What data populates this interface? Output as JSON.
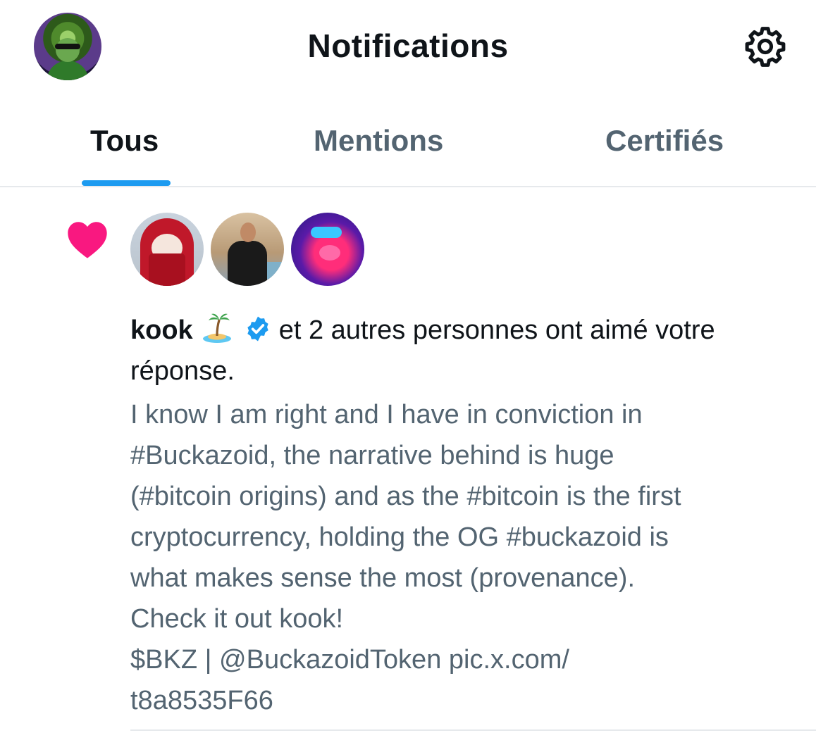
{
  "header": {
    "title": "Notifications",
    "avatar_icon": "profile-avatar",
    "settings_icon": "gear-icon"
  },
  "tabs": [
    {
      "label": "Tous",
      "active": true
    },
    {
      "label": "Mentions",
      "active": false
    },
    {
      "label": "Certifiés",
      "active": false
    }
  ],
  "colors": {
    "accent": "#1d9bf0",
    "heart": "#f91880",
    "text_primary": "#0f1419",
    "text_secondary": "#536471"
  },
  "notification": {
    "type_icon": "heart-icon",
    "likers": [
      "liker-avatar-1",
      "liker-avatar-2",
      "liker-avatar-3"
    ],
    "username": "kook",
    "username_emoji": "palm-island-emoji",
    "verified_icon": "verified-badge-icon",
    "action_text": "et 2 autres personnes ont aimé votre réponse.",
    "tweet_text": "I know I am right and I have in conviction in\n#Buckazoid, the narrative behind is huge\n(#bitcoin origins) and as the #bitcoin is the first\ncryptocurrency, holding the OG #buckazoid is\nwhat makes sense the most (provenance).\nCheck it out kook!\n$BKZ | @BuckazoidToken pic.x.com/\nt8a8535F66"
  }
}
